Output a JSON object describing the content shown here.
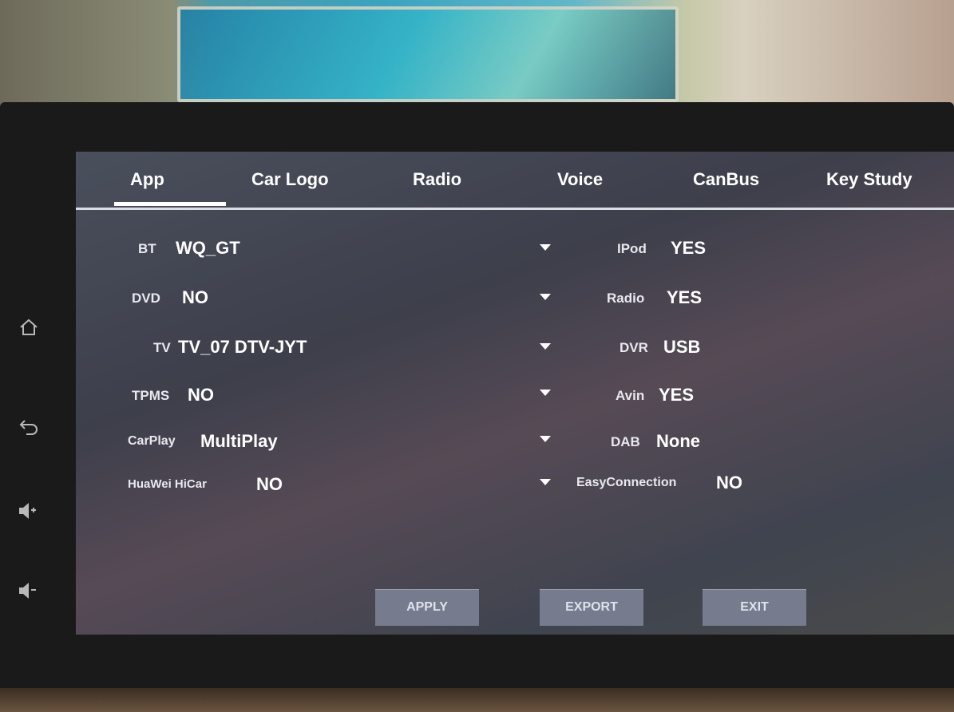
{
  "tabs": [
    {
      "label": "App",
      "active": true
    },
    {
      "label": "Car Logo",
      "active": false
    },
    {
      "label": "Radio",
      "active": false
    },
    {
      "label": "Voice",
      "active": false
    },
    {
      "label": "CanBus",
      "active": false
    },
    {
      "label": "Key Study",
      "active": false
    }
  ],
  "left_settings": [
    {
      "label": "BT",
      "value": "WQ_GT"
    },
    {
      "label": "DVD",
      "value": "NO"
    },
    {
      "label": "TV",
      "value": "TV_07 DTV-JYT"
    },
    {
      "label": "TPMS",
      "value": "NO"
    },
    {
      "label": "CarPlay",
      "value": "MultiPlay"
    },
    {
      "label": "HuaWei HiCar",
      "value": "NO"
    }
  ],
  "right_settings": [
    {
      "label": "IPod",
      "value": "YES"
    },
    {
      "label": "Radio",
      "value": "YES"
    },
    {
      "label": "DVR",
      "value": "USB"
    },
    {
      "label": "Avin",
      "value": "YES"
    },
    {
      "label": "DAB",
      "value": "None"
    },
    {
      "label": "EasyConnection",
      "value": "NO"
    }
  ],
  "buttons": {
    "apply": "APPLY",
    "export": "EXPORT",
    "exit": "EXIT"
  },
  "side_buttons": {
    "home": "home-icon",
    "back": "back-icon",
    "volume_up": "volume-up-icon",
    "volume_down": "volume-down-icon"
  },
  "colors": {
    "button_bg": "#767c8e",
    "text": "#ffffff",
    "tab_underline": "#d9dde4"
  }
}
